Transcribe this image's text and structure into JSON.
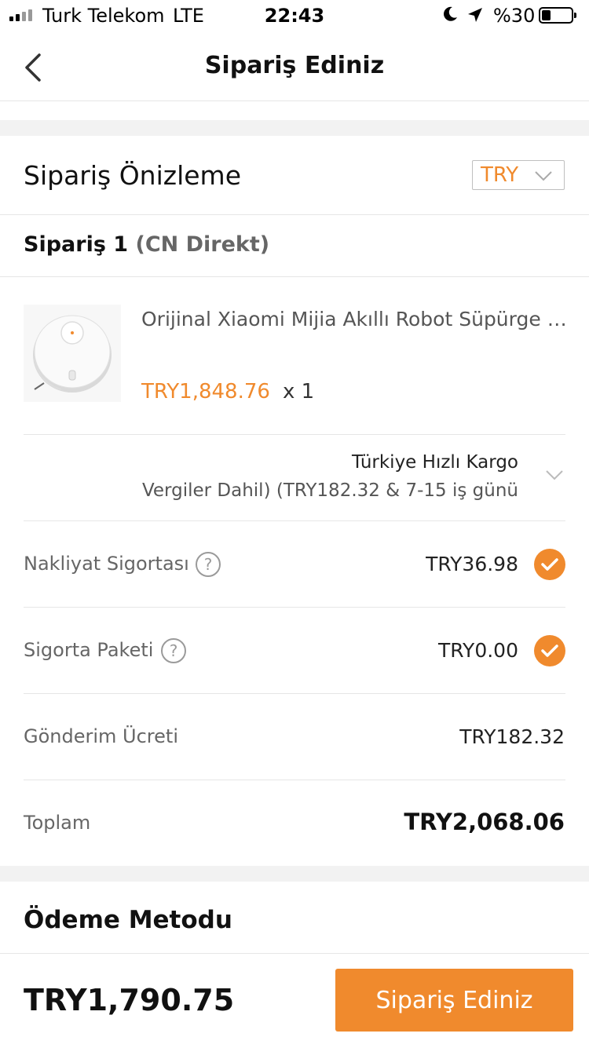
{
  "status_bar": {
    "carrier": "Turk Telekom",
    "network": "LTE",
    "time": "22:43",
    "battery_percent": "%30",
    "battery_level": 0.3
  },
  "nav": {
    "title": "Sipariş Ediniz",
    "back_icon": "chevron-left-icon"
  },
  "preview": {
    "title": "Sipariş Önizleme",
    "currency": "TRY"
  },
  "order": {
    "label": "Sipariş 1",
    "source": "(CN Direkt)"
  },
  "product": {
    "name": "Orijinal Xiaomi Mijia Akıllı Robot Süpürge LS...",
    "price": "TRY1,848.76",
    "quantity": "x 1"
  },
  "shipping": {
    "method": "Türkiye Hızlı Kargo",
    "detail": "Vergiler Dahil) (TRY182.32 & 7-15  iş günü"
  },
  "rows": {
    "shipping_insurance": {
      "label": "Nakliyat Sigortası",
      "value": "TRY36.98",
      "checked": true
    },
    "insurance_package": {
      "label": "Sigorta Paketi",
      "value": "TRY0.00",
      "checked": true
    },
    "shipping_fee": {
      "label": "Gönderim Ücreti",
      "value": "TRY182.32"
    },
    "total": {
      "label": "Toplam",
      "value": "TRY2,068.06"
    }
  },
  "payment": {
    "title": "Ödeme Metodu"
  },
  "bottom": {
    "total": "TRY1,790.75",
    "button_label": "Sipariş Ediniz"
  },
  "colors": {
    "accent": "#f08a2d",
    "divider": "#e6e6e6",
    "band": "#f2f2f2"
  }
}
